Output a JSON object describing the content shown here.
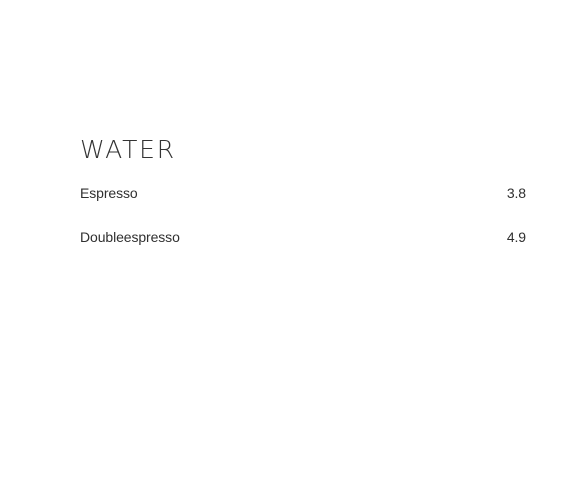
{
  "menu": {
    "section_title": "WATER",
    "items": [
      {
        "name": "Espresso",
        "price": "3.8"
      },
      {
        "name": "Doubleespresso",
        "price": "4.9"
      }
    ]
  }
}
